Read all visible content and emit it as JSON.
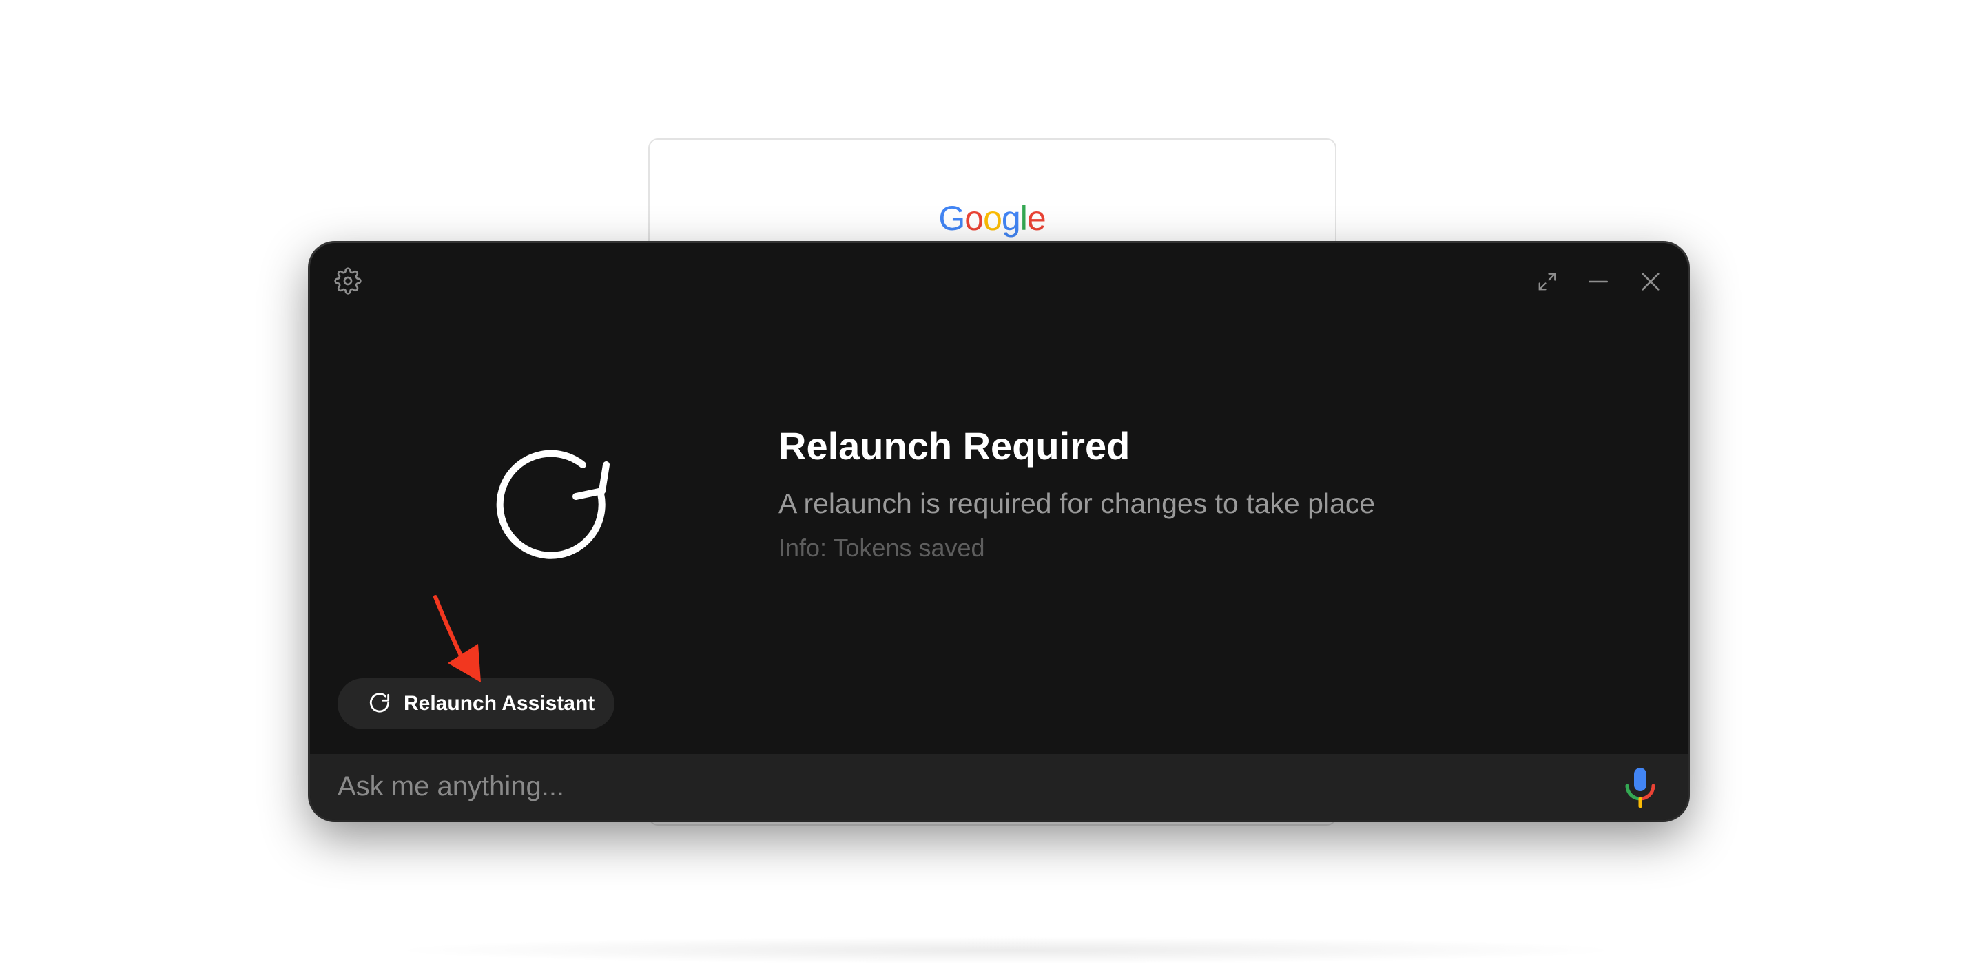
{
  "background": {
    "logo_text": "Google",
    "logo_colors": [
      "#4285F4",
      "#EA4335",
      "#FBBC05",
      "#4285F4",
      "#34A853",
      "#EA4335"
    ]
  },
  "assistant": {
    "toolbar": {
      "settings_icon": "gear-icon",
      "expand_icon": "expand-icon",
      "minimize_icon": "minimize-icon",
      "close_icon": "close-icon"
    },
    "status": {
      "icon": "refresh-icon",
      "title": "Relaunch Required",
      "subtitle": "A relaunch is required for changes to take place",
      "info": "Info: Tokens saved"
    },
    "relaunch_button": {
      "icon": "refresh-icon",
      "label": "Relaunch Assistant"
    },
    "annotation": {
      "icon": "red-arrow-annotation",
      "color": "#F2371F"
    },
    "input": {
      "placeholder": "Ask me anything...",
      "value": "",
      "mic_icon": "microphone-icon"
    }
  },
  "colors": {
    "panel_bg": "#141414",
    "input_bar_bg": "#222222",
    "button_bg": "#262626",
    "title_text": "#FFFFFF",
    "subtitle_text": "#9A9A9A",
    "info_text": "#5E5E5E"
  }
}
